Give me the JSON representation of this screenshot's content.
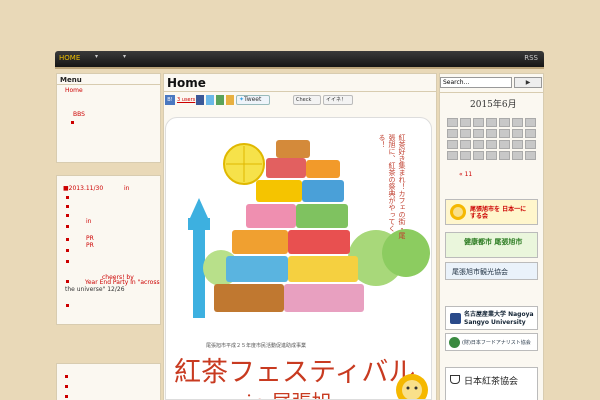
{
  "nav": {
    "home": "HOME",
    "mark1": "▾",
    "mark2": "▾",
    "rss": "RSS"
  },
  "sidebar": {
    "menu_title": "Menu",
    "home": "Home",
    "bbs": "BBS",
    "posts": {
      "date": "■2013.11/30",
      "in1": "in",
      "in2": "in",
      "pr1": "PR",
      "pr2": "PR",
      "cheers": "cheers! by",
      "year_end": "Year End Party in \"across",
      "universe": "the universe\" 12/26"
    }
  },
  "main": {
    "title": "Home",
    "share": {
      "count": "3 users",
      "tweet": "Tweet",
      "check": "Check",
      "iine": "イイネ！"
    },
    "poster": {
      "tagline": "紅茶好き集まれ！カフェの街・尾張旭に、紅茶の祭典がやってくる！",
      "subsidy": "尾張旭市平成２５年度市民活動促進助成事業",
      "headline": "紅茶フェスティバル",
      "subline": "in 尾張旭"
    }
  },
  "right": {
    "search_placeholder": "Search...",
    "search_button": "▶",
    "calendar_title": "2015年6月",
    "calendar_prev": "« 11",
    "banners": {
      "nihon": "尾張旭市を 日本一に する会",
      "kenko": "健康都市 尾張旭市",
      "kanko": "尾張旭市観光協会",
      "sangyo": "名古屋産業大学 Nagoya Sangyo University",
      "food": "(財)日本フードアナリスト協会",
      "tea": "日本紅茶協会"
    }
  },
  "colors": {
    "accent": "#c00000",
    "nav_active": "#f0c000",
    "bg": "#e9d9b8"
  }
}
